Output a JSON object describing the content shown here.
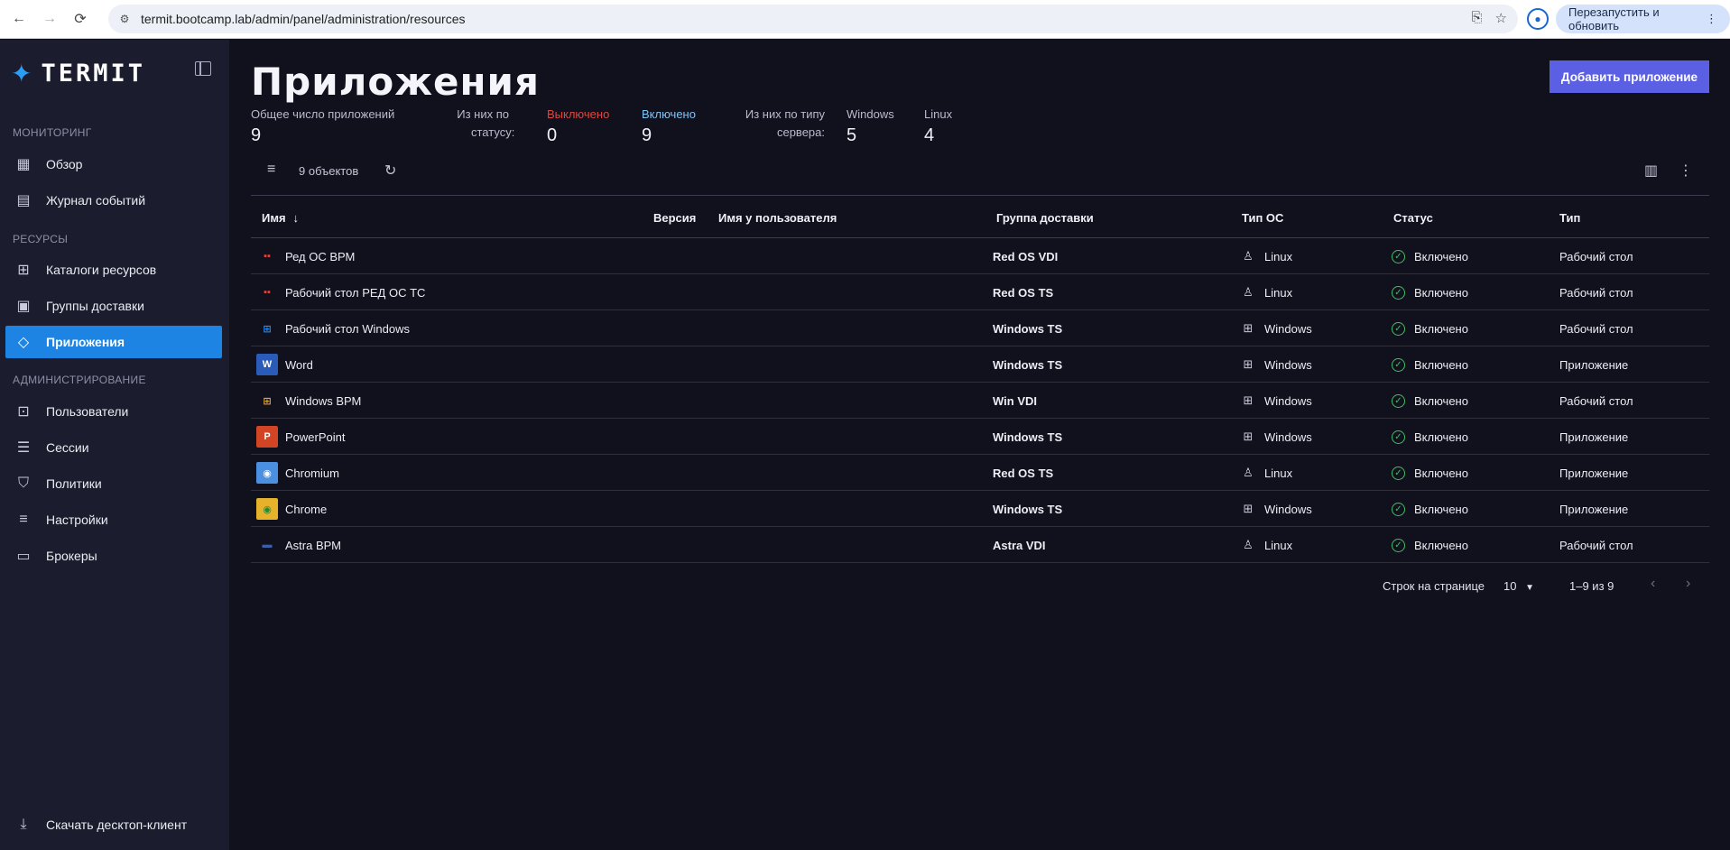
{
  "browser": {
    "url": "termit.bootcamp.lab/admin/panel/administration/resources",
    "relaunch_label": "Перезапустить и обновить"
  },
  "sidebar": {
    "logo": "TERMIT",
    "sections": {
      "monitoring": "МОНИТОРИНГ",
      "resources": "РЕСУРСЫ",
      "administration": "АДМИНИСТРИРОВАНИЕ"
    },
    "items": [
      {
        "label": "Обзор",
        "icon": "dashboard-icon"
      },
      {
        "label": "Журнал событий",
        "icon": "event-log-icon"
      },
      {
        "label": "Каталоги ресурсов",
        "icon": "catalog-icon"
      },
      {
        "label": "Группы доставки",
        "icon": "delivery-group-icon"
      },
      {
        "label": "Приложения",
        "icon": "apps-icon"
      },
      {
        "label": "Пользователи",
        "icon": "users-icon"
      },
      {
        "label": "Сессии",
        "icon": "sessions-icon"
      },
      {
        "label": "Политики",
        "icon": "policy-icon"
      },
      {
        "label": "Настройки",
        "icon": "settings-icon"
      },
      {
        "label": "Брокеры",
        "icon": "brokers-icon"
      }
    ],
    "download_label": "Скачать десктоп-клиент"
  },
  "page": {
    "title": "Приложения",
    "add_button": "Добавить приложение"
  },
  "stats": {
    "total_label": "Общее число приложений",
    "total_value": "9",
    "status_label_1": "Из них по",
    "status_label_2": "статусу:",
    "disabled_label": "Выключено",
    "disabled_value": "0",
    "enabled_label": "Включено",
    "enabled_value": "9",
    "type_label_1": "Из них по типу",
    "type_label_2": "сервера:",
    "windows_label": "Windows",
    "windows_value": "5",
    "linux_label": "Linux",
    "linux_value": "4",
    "colors": {
      "disabled": "#e0453d",
      "enabled": "#7cc4f5"
    }
  },
  "toolbar": {
    "count_text": "9 объектов"
  },
  "table": {
    "headers": [
      "Имя",
      "Версия",
      "Имя у пользователя",
      "Группа доставки",
      "Тип ОС",
      "Статус",
      "Тип"
    ],
    "rows": [
      {
        "name": "Ред ОС ВРМ",
        "icon": "redos-icon",
        "group": "Red OS VDI",
        "os": "Linux",
        "status": "Включено",
        "type": "Рабочий стол"
      },
      {
        "name": "Рабочий стол РЕД ОС ТС",
        "icon": "redos-icon",
        "group": "Red OS TS",
        "os": "Linux",
        "status": "Включено",
        "type": "Рабочий стол"
      },
      {
        "name": "Рабочий стол Windows",
        "icon": "windows-icon",
        "group": "Windows TS",
        "os": "Windows",
        "status": "Включено",
        "type": "Рабочий стол"
      },
      {
        "name": "Word",
        "icon": "word-icon",
        "group": "Windows TS",
        "os": "Windows",
        "status": "Включено",
        "type": "Приложение"
      },
      {
        "name": "Windows ВРМ",
        "icon": "windows-xp-icon",
        "group": "Win VDI",
        "os": "Windows",
        "status": "Включено",
        "type": "Рабочий стол"
      },
      {
        "name": "PowerPoint",
        "icon": "powerpoint-icon",
        "group": "Windows TS",
        "os": "Windows",
        "status": "Включено",
        "type": "Приложение"
      },
      {
        "name": "Chromium",
        "icon": "chromium-icon",
        "group": "Red OS TS",
        "os": "Linux",
        "status": "Включено",
        "type": "Приложение"
      },
      {
        "name": "Chrome",
        "icon": "chrome-icon",
        "group": "Windows TS",
        "os": "Windows",
        "status": "Включено",
        "type": "Приложение"
      },
      {
        "name": "Astra ВРМ",
        "icon": "astra-icon",
        "group": "Astra VDI",
        "os": "Linux",
        "status": "Включено",
        "type": "Рабочий стол"
      }
    ]
  },
  "pagination": {
    "rows_label": "Строк на странице",
    "rows_value": "10",
    "range": "1–9 из 9"
  }
}
